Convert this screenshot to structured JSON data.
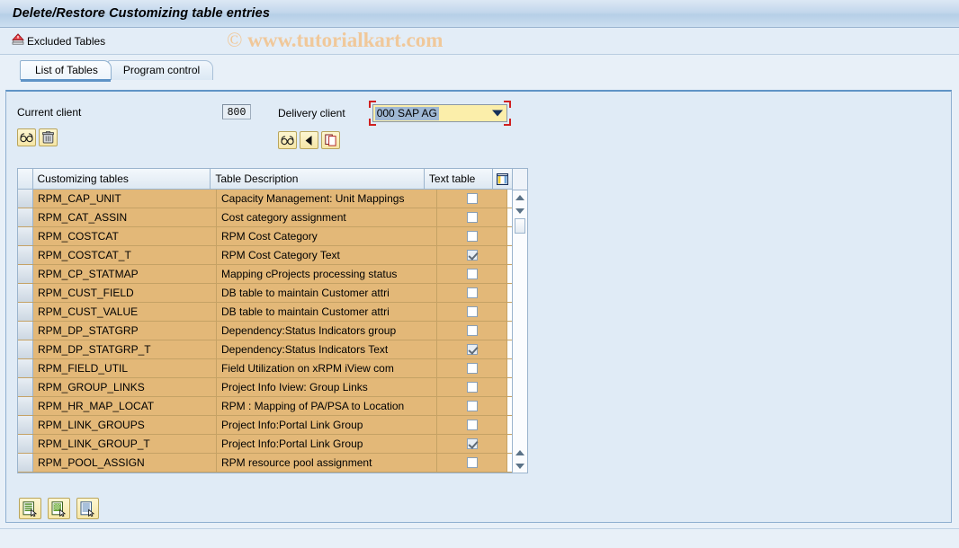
{
  "window": {
    "title": "Delete/Restore Customizing table entries"
  },
  "app_toolbar": {
    "excluded_tables_label": "Excluded Tables",
    "excluded_tables_icon": "warning-stack-icon"
  },
  "watermark": {
    "copyright": "©",
    "text": "www.tutorialkart.com"
  },
  "tabs": [
    {
      "label": "List of Tables",
      "active": true
    },
    {
      "label": "Program control",
      "active": false
    }
  ],
  "form": {
    "current_client": {
      "label": "Current client",
      "value": "800",
      "buttons": [
        {
          "name": "display-current-client-button",
          "icon": "glasses-icon"
        },
        {
          "name": "delete-current-client-entries-button",
          "icon": "trash-icon"
        }
      ]
    },
    "delivery_client": {
      "label": "Delivery client",
      "value": "000 SAP AG",
      "selected": true,
      "focus_color": "#d02020",
      "field_color": "#fbeeaa",
      "buttons": [
        {
          "name": "display-delivery-client-button",
          "icon": "glasses-icon"
        },
        {
          "name": "restore-back-button",
          "icon": "triangle-left-icon"
        },
        {
          "name": "copy-tables-button",
          "icon": "copy-icon"
        }
      ]
    }
  },
  "table": {
    "columns": [
      "",
      "Customizing tables",
      "Table Description",
      "Text table",
      ""
    ],
    "config_icon": "table-settings-icon",
    "rows": [
      {
        "name": "RPM_CAP_UNIT",
        "description": "Capacity Management: Unit Mappings",
        "text_table": false
      },
      {
        "name": "RPM_CAT_ASSIN",
        "description": "Cost category assignment",
        "text_table": false
      },
      {
        "name": "RPM_COSTCAT",
        "description": "RPM Cost Category",
        "text_table": false
      },
      {
        "name": "RPM_COSTCAT_T",
        "description": "RPM Cost Category Text",
        "text_table": true
      },
      {
        "name": "RPM_CP_STATMAP",
        "description": "Mapping cProjects processing status",
        "text_table": false
      },
      {
        "name": "RPM_CUST_FIELD",
        "description": "DB table to maintain Customer attri",
        "text_table": false
      },
      {
        "name": "RPM_CUST_VALUE",
        "description": "DB table to maintain Customer attri",
        "text_table": false
      },
      {
        "name": "RPM_DP_STATGRP",
        "description": "Dependency:Status Indicators group",
        "text_table": false
      },
      {
        "name": "RPM_DP_STATGRP_T",
        "description": "Dependency:Status Indicators Text",
        "text_table": true
      },
      {
        "name": "RPM_FIELD_UTIL",
        "description": "Field Utilization on xRPM iView com",
        "text_table": false
      },
      {
        "name": "RPM_GROUP_LINKS",
        "description": "Project Info Iview: Group Links",
        "text_table": false
      },
      {
        "name": "RPM_HR_MAP_LOCAT",
        "description": "RPM : Mapping of PA/PSA to Location",
        "text_table": false
      },
      {
        "name": "RPM_LINK_GROUPS",
        "description": "Project Info:Portal Link Group",
        "text_table": false
      },
      {
        "name": "RPM_LINK_GROUP_T",
        "description": "Project Info:Portal Link Group",
        "text_table": true
      },
      {
        "name": "RPM_POOL_ASSIGN",
        "description": "RPM resource pool assignment",
        "text_table": false
      }
    ]
  },
  "bottom_buttons": [
    {
      "name": "select-all-rows-button",
      "icon": "document-select-green-icon"
    },
    {
      "name": "deselect-all-rows-button",
      "icon": "document-deselect-green-icon"
    },
    {
      "name": "list-details-button",
      "icon": "document-list-blue-icon"
    }
  ],
  "colors": {
    "row_background": "#e3b878",
    "panel_background": "#e0ebf6",
    "accent": "#5f93c6",
    "field_yellow": "#fbeeaa",
    "focus_red": "#d02020"
  }
}
